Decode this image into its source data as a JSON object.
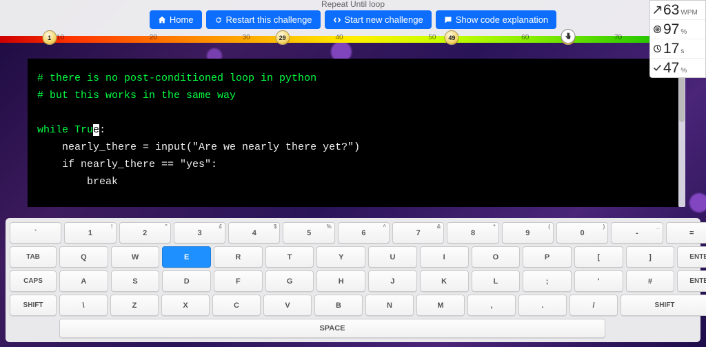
{
  "title": "Repeat Until loop",
  "buttons": {
    "home": "Home",
    "restart": "Restart this challenge",
    "startnew": "Start new challenge",
    "explain": "Show code explanation"
  },
  "gradient": {
    "ticks": [
      10,
      20,
      30,
      40,
      50,
      60,
      70
    ],
    "badges": [
      {
        "value": 1,
        "pos": 7
      },
      {
        "value": 29,
        "pos": 40
      },
      {
        "value": 49,
        "pos": 64
      },
      {
        "value": 63,
        "pos": 80.5
      }
    ],
    "pointer_pos": 80.5
  },
  "stats": {
    "wpm": {
      "value": "63",
      "unit": "WPM"
    },
    "accuracy": {
      "value": "97",
      "unit": "%"
    },
    "time": {
      "value": "17",
      "unit": "s"
    },
    "progress": {
      "value": "47",
      "unit": "%"
    }
  },
  "code": {
    "line1": "# there is no post-conditioned loop in python",
    "line2": "# but this works in the same way",
    "kw_while": "while",
    "kw_tru": "Tru",
    "kw_e": "e",
    "colon": ":",
    "l4": "    nearly_there = input(\"Are we nearly there yet?\")",
    "l5": "    if nearly_there == \"yes\":",
    "l6": "        break"
  },
  "keyboard": {
    "row1": [
      {
        "main": "`",
        "sup": ""
      },
      {
        "main": "1",
        "sup": "!"
      },
      {
        "main": "2",
        "sup": "\""
      },
      {
        "main": "3",
        "sup": "£"
      },
      {
        "main": "4",
        "sup": "$"
      },
      {
        "main": "5",
        "sup": "%"
      },
      {
        "main": "6",
        "sup": "^"
      },
      {
        "main": "7",
        "sup": "&"
      },
      {
        "main": "8",
        "sup": "*"
      },
      {
        "main": "9",
        "sup": "("
      },
      {
        "main": "0",
        "sup": ")"
      },
      {
        "main": "-",
        "sup": "_"
      },
      {
        "main": "=",
        "sup": "+"
      }
    ],
    "tab": "TAB",
    "row2": [
      "Q",
      "W",
      "E",
      "R",
      "T",
      "Y",
      "U",
      "I",
      "O",
      "P",
      "[",
      "]"
    ],
    "enter": "ENTER",
    "caps": "CAPS",
    "row3": [
      "A",
      "S",
      "D",
      "F",
      "G",
      "H",
      "J",
      "K",
      "L",
      ";",
      "'",
      "#"
    ],
    "shift": "SHIFT",
    "row4": [
      "\\",
      "Z",
      "X",
      "C",
      "V",
      "B",
      "N",
      "M",
      ",",
      ".",
      "/"
    ],
    "space": "SPACE",
    "active_key": "E"
  }
}
